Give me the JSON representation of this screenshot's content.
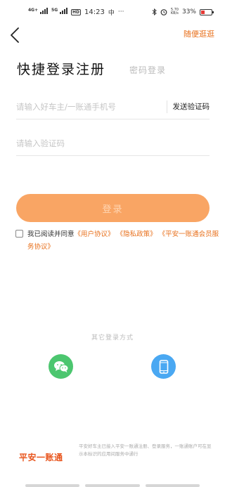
{
  "status_bar": {
    "network_label": "4G+",
    "network2_label": "5G",
    "hd_label": "HD",
    "time": "14:23",
    "notification_glyph": "中",
    "speed_value": "5.70",
    "speed_unit": "KB/s",
    "battery_percent": "33%",
    "battery_level": 0.33,
    "battery_color": "#e53935"
  },
  "header": {
    "back_icon": "chevron-left-icon",
    "skip_label": "随便逛逛"
  },
  "title": {
    "main": "快捷登录注册",
    "alt": "密码登录"
  },
  "form": {
    "phone_placeholder": "请输入好车主/一账通手机号",
    "send_code_label": "发送验证码",
    "code_placeholder": "请输入验证码"
  },
  "login_button": {
    "label": "登录",
    "color": "#f9a564"
  },
  "agreement": {
    "prefix": "我已阅读并同意",
    "link_user": "《用户协议》",
    "link_privacy": "《隐私政策》",
    "link_account": "《平安一账通会员服务协议》",
    "checked": false
  },
  "other_login": {
    "title": "其它登录方式",
    "wechat_icon": "wechat-icon",
    "phone_icon": "mobile-phone-icon"
  },
  "footer": {
    "brand": "平安一账通",
    "brand_color": "#e8541c",
    "note": "平安好车主已接入平安一账通注册、登录服务，一账通账户可在显示本标识的应用间服务中通行"
  },
  "accent_color": "#e8701c"
}
